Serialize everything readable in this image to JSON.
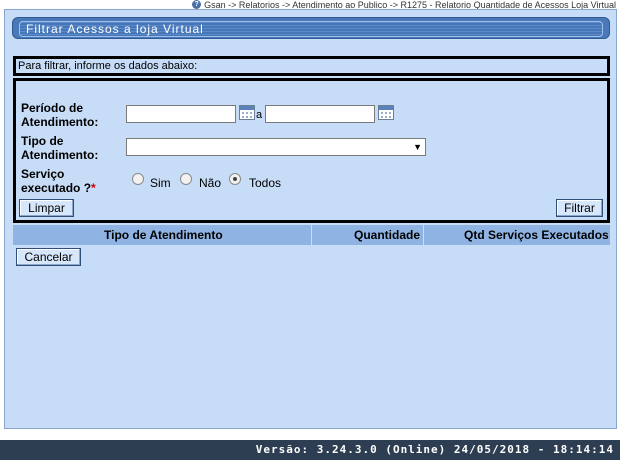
{
  "breadcrumb": {
    "text": "Gsan -> Relatorios -> Atendimento ao Publico -> R1275 - Relatorio Quantidade de Acessos Loja Virtual"
  },
  "window": {
    "title": "Filtrar Acessos a loja Virtual"
  },
  "hint": "Para filtrar, informe os dados abaixo:",
  "form": {
    "periodo_label_1": "Período de",
    "periodo_label_2": "Atendimento:",
    "periodo_inicio_value": "",
    "periodo_fim_value": "",
    "periodo_separator": "a",
    "tipo_label_1": "Tipo de",
    "tipo_label_2": "Atendimento:",
    "tipo_selected": "",
    "servico_label_1": "Serviço",
    "servico_label_2": "executado ?",
    "required_mark": "*",
    "radio_options": [
      "Sim",
      "Não",
      "Todos"
    ],
    "radio_selected": "Todos",
    "limpar_label": "Limpar",
    "filtrar_label": "Filtrar"
  },
  "table": {
    "columns": [
      "Tipo de Atendimento",
      "Quantidade",
      "Qtd Serviços Executados"
    ]
  },
  "cancelar_label": "Cancelar",
  "footer": {
    "version": "Versão: 3.24.3.0 (Online) 24/05/2018 - 18:14:14"
  },
  "colors": {
    "panel_bg": "#c7dcf7",
    "title_bar": "#4a79b9",
    "table_header": "#8fb4e3",
    "footer_bg": "#2e3e52",
    "required": "#d00000"
  }
}
